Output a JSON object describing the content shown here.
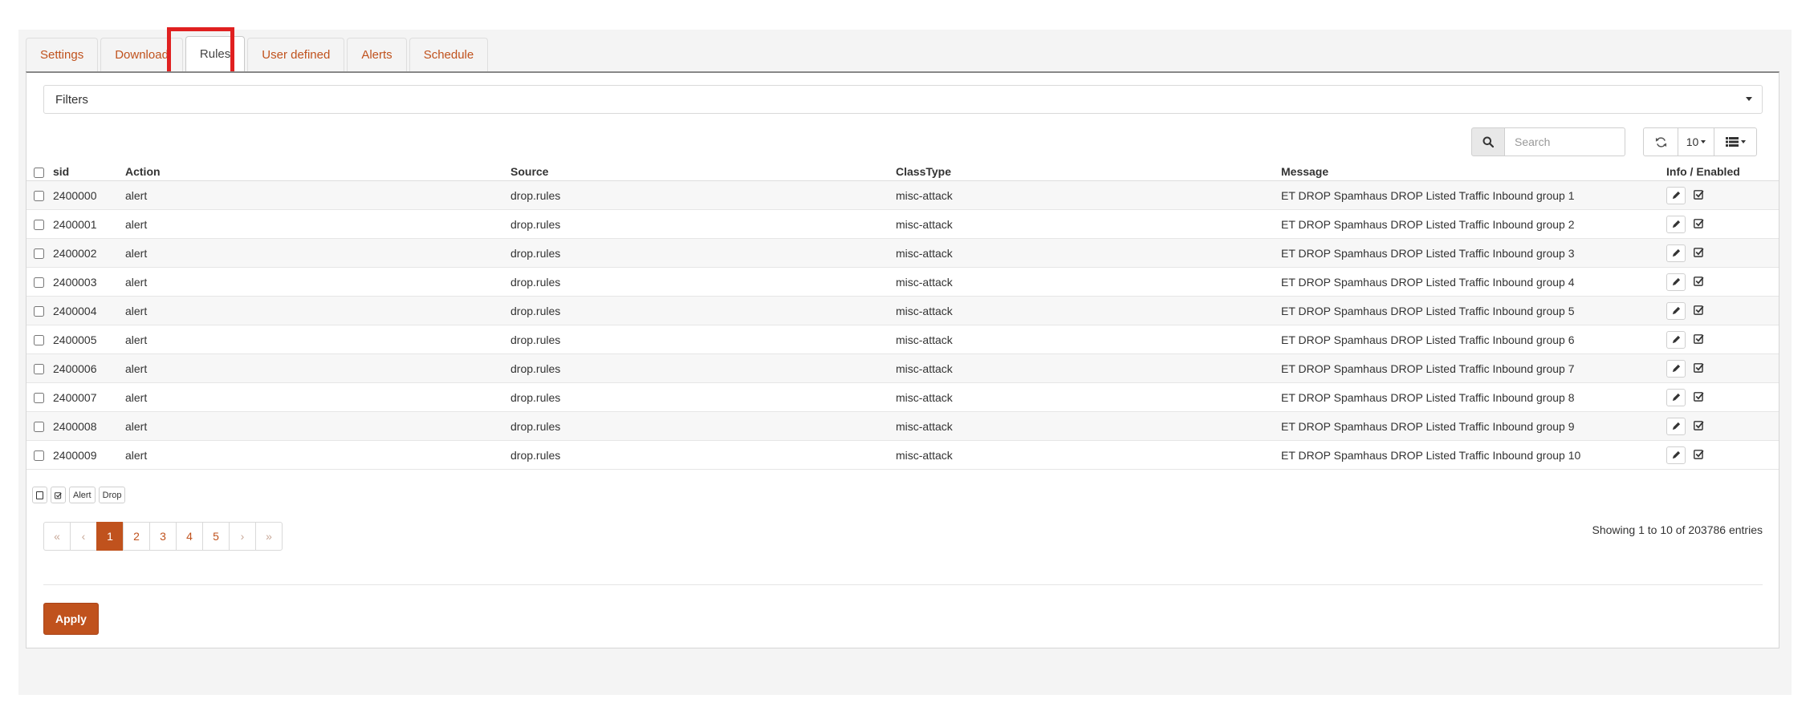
{
  "tabs": [
    {
      "label": "Settings",
      "active": false
    },
    {
      "label": "Download",
      "active": false
    },
    {
      "label": "Rules",
      "active": true
    },
    {
      "label": "User defined",
      "active": false
    },
    {
      "label": "Alerts",
      "active": false
    },
    {
      "label": "Schedule",
      "active": false
    }
  ],
  "filters": {
    "label": "Filters"
  },
  "toolbar": {
    "search_placeholder": "Search",
    "page_size": "10",
    "icons": [
      "search-icon",
      "refresh-icon",
      "columns-icon"
    ]
  },
  "table": {
    "headers": {
      "sid": "sid",
      "action": "Action",
      "source": "Source",
      "classtype": "ClassType",
      "message": "Message",
      "info": "Info / Enabled"
    },
    "rows": [
      {
        "sid": "2400000",
        "action": "alert",
        "source": "drop.rules",
        "classtype": "misc-attack",
        "message": "ET DROP Spamhaus DROP Listed Traffic Inbound group 1"
      },
      {
        "sid": "2400001",
        "action": "alert",
        "source": "drop.rules",
        "classtype": "misc-attack",
        "message": "ET DROP Spamhaus DROP Listed Traffic Inbound group 2"
      },
      {
        "sid": "2400002",
        "action": "alert",
        "source": "drop.rules",
        "classtype": "misc-attack",
        "message": "ET DROP Spamhaus DROP Listed Traffic Inbound group 3"
      },
      {
        "sid": "2400003",
        "action": "alert",
        "source": "drop.rules",
        "classtype": "misc-attack",
        "message": "ET DROP Spamhaus DROP Listed Traffic Inbound group 4"
      },
      {
        "sid": "2400004",
        "action": "alert",
        "source": "drop.rules",
        "classtype": "misc-attack",
        "message": "ET DROP Spamhaus DROP Listed Traffic Inbound group 5"
      },
      {
        "sid": "2400005",
        "action": "alert",
        "source": "drop.rules",
        "classtype": "misc-attack",
        "message": "ET DROP Spamhaus DROP Listed Traffic Inbound group 6"
      },
      {
        "sid": "2400006",
        "action": "alert",
        "source": "drop.rules",
        "classtype": "misc-attack",
        "message": "ET DROP Spamhaus DROP Listed Traffic Inbound group 7"
      },
      {
        "sid": "2400007",
        "action": "alert",
        "source": "drop.rules",
        "classtype": "misc-attack",
        "message": "ET DROP Spamhaus DROP Listed Traffic Inbound group 8"
      },
      {
        "sid": "2400008",
        "action": "alert",
        "source": "drop.rules",
        "classtype": "misc-attack",
        "message": "ET DROP Spamhaus DROP Listed Traffic Inbound group 9"
      },
      {
        "sid": "2400009",
        "action": "alert",
        "source": "drop.rules",
        "classtype": "misc-attack",
        "message": "ET DROP Spamhaus DROP Listed Traffic Inbound group 10"
      }
    ]
  },
  "bulk_actions": {
    "alert_label": "Alert",
    "drop_label": "Drop"
  },
  "pagination": {
    "first": "«",
    "prev": "‹",
    "pages": [
      "1",
      "2",
      "3",
      "4",
      "5"
    ],
    "current": "1",
    "next": "›",
    "last": "»"
  },
  "footer": {
    "showing": "Showing 1 to 10 of 203786 entries",
    "apply_label": "Apply"
  },
  "colors": {
    "accent": "#c0521d",
    "highlight": "#e02020"
  }
}
